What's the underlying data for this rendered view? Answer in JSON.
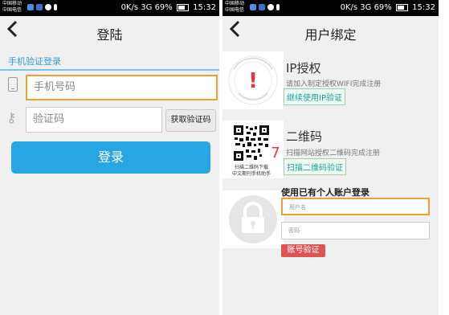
{
  "status_bar": {
    "carrier_line1": "中国移动",
    "carrier_line2": "中国电信",
    "right": "0K/s",
    "signal": "3G",
    "battery": "69%",
    "time": "15:32"
  },
  "left": {
    "title": "登陆",
    "tab_label": "手机验证登录",
    "phone_placeholder": "手机号码",
    "code_placeholder": "验证码",
    "get_code_label": "获取验证码",
    "login_label": "登录"
  },
  "right": {
    "title": "用户绑定",
    "ip": {
      "title": "IP授权",
      "subtitle": "请加入制定授权WIFI完成注册",
      "button": "继续使用IP验证",
      "exclaim": "!"
    },
    "qr": {
      "title": "二维码",
      "subtitle": "扫描网站授权二维码完成注册",
      "button": "扫描二维码验证",
      "caption1": "扫描二维码下载",
      "caption2": "中文期刊手机助手",
      "digit": "7"
    },
    "account": {
      "label": "使用已有个人账户登录",
      "username_placeholder": "用户名",
      "password_placeholder": "密码",
      "button": "账号验证"
    }
  },
  "colors": {
    "accent_blue": "#28a6e4",
    "focus_orange": "#f0a030",
    "ip_red": "#e03a3a",
    "account_button_red": "#e05353"
  },
  "icons": {
    "back": "chevron-left-icon",
    "phone": "phone-icon",
    "key": "key-icon",
    "lock": "lock-icon"
  }
}
